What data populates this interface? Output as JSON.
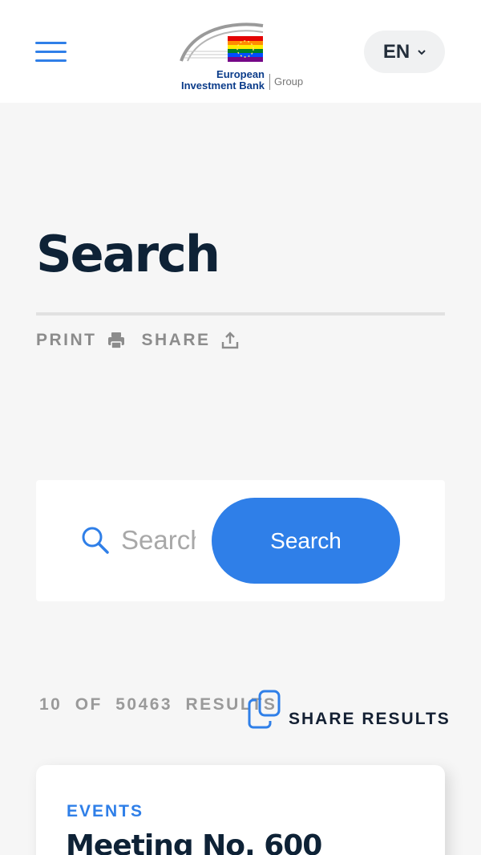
{
  "header": {
    "logo": {
      "line1": "European",
      "line2": "Investment Bank",
      "group": "Group"
    },
    "language": {
      "code": "EN"
    }
  },
  "page": {
    "title": "Search",
    "print_label": "PRINT",
    "share_label": "SHARE"
  },
  "search": {
    "placeholder": "Search",
    "button_label": "Search"
  },
  "results": {
    "shown": "10",
    "of_label": "OF",
    "total": "50463",
    "results_label": "RESULTS",
    "share_label": "SHARE RESULTS",
    "items": [
      {
        "category": "EVENTS",
        "title": "Meeting No. 600"
      }
    ]
  },
  "colors": {
    "accent": "#2f7fe8",
    "title": "#0e2236",
    "muted": "#8c8c8c"
  }
}
